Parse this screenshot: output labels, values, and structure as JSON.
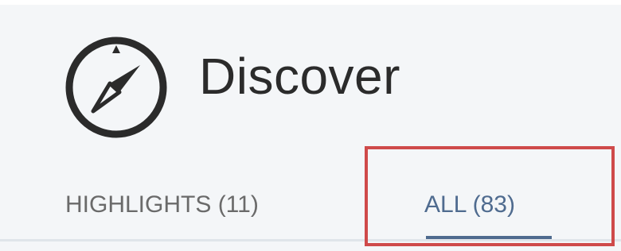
{
  "header": {
    "icon": "compass-icon",
    "title": "Discover"
  },
  "tabs": [
    {
      "label": "HIGHLIGHTS (11)",
      "selected": false
    },
    {
      "label": "ALL (83)",
      "selected": true
    }
  ],
  "colors": {
    "background": "#f4f6f8",
    "text_primary": "#2b2b2b",
    "tab_inactive": "#6a6a6a",
    "tab_active": "#4f6b8f",
    "annotation_box": "#cf4a4a"
  }
}
